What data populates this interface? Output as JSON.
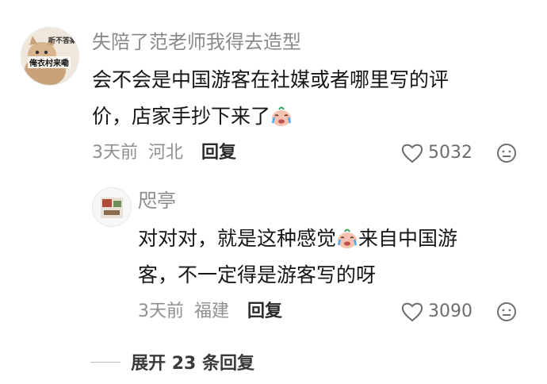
{
  "comment": {
    "username": "失陪了范老师我得去造型",
    "avatar": {
      "caption_top": "听不答案",
      "caption_bottom": "俺衣村来嘞"
    },
    "text_line1": "会不会是中国游客在社媒或者哪里写的评",
    "text_line2": "价，店家手抄下来了",
    "emoji": "crying-face-icon",
    "time": "3天前",
    "location": "河北",
    "reply_label": "回复",
    "likes": "5032"
  },
  "reply": {
    "username": "咫亭",
    "text_line1_part1": "对对对，就是这种感觉",
    "text_line1_part2": "来自中国游",
    "text_line2": "客，不一定得是游客写的呀",
    "emoji": "crying-face-icon",
    "time": "3天前",
    "location": "福建",
    "reply_label": "回复",
    "likes": "3090"
  },
  "expand": {
    "label": "展开 23 条回复"
  },
  "colors": {
    "text": "#161616",
    "meta": "#8f8f8f",
    "username": "#8a8a8a"
  }
}
